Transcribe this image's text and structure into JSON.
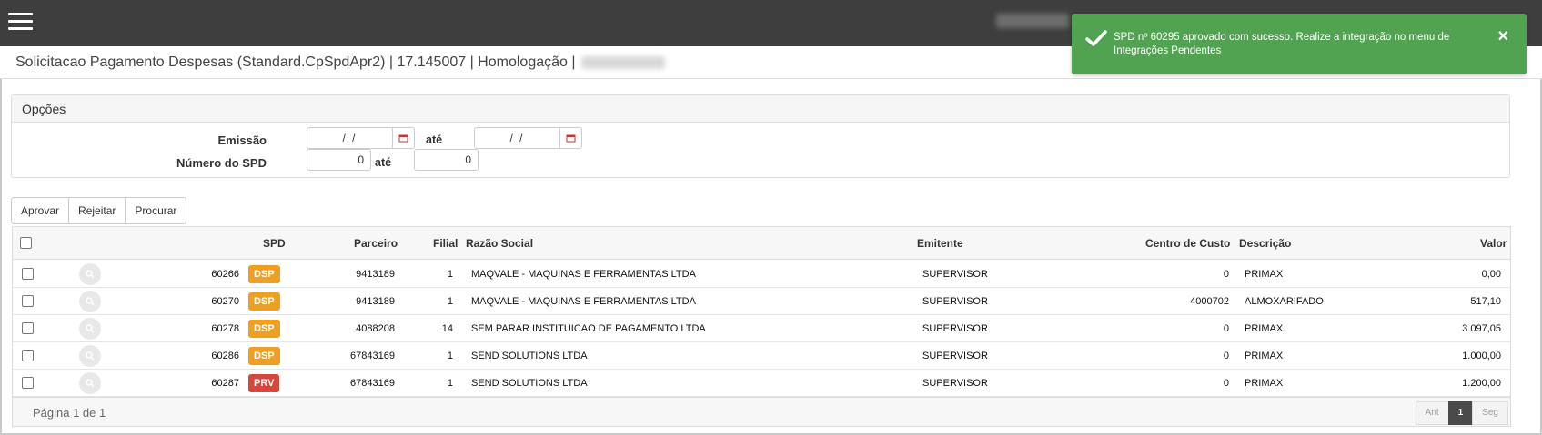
{
  "header": {
    "page_title": "Solicitacao Pagamento Despesas (Standard.CpSpdApr2) | 17.145007 | Homologação |"
  },
  "toast": {
    "message": "SPD nº 60295 aprovado com sucesso. Realize a integração no menu de Integrações Pendentes",
    "close": "×",
    "color": "#51a351"
  },
  "options": {
    "title": "Opções",
    "emissao_label": "Emissão",
    "numero_label": "Número do SPD",
    "ate_label": "até",
    "date_from": "/ /",
    "date_to": "/ /",
    "num_from": "0",
    "num_to": "0"
  },
  "toolbar": {
    "aprovar": "Aprovar",
    "rejeitar": "Rejeitar",
    "procurar": "Procurar"
  },
  "table": {
    "headers": {
      "spd": "SPD",
      "parceiro": "Parceiro",
      "filial": "Filial",
      "razao": "Razão Social",
      "emitente": "Emitente",
      "centro": "Centro de Custo",
      "descricao": "Descrição",
      "valor": "Valor"
    },
    "rows": [
      {
        "spd": "60266",
        "badge": "DSP",
        "parceiro": "9413189",
        "filial": "1",
        "razao": "MAQVALE - MAQUINAS E FERRAMENTAS LTDA",
        "emitente": "SUPERVISOR",
        "centro": "0",
        "descricao": "PRIMAX",
        "valor": "0,00"
      },
      {
        "spd": "60270",
        "badge": "DSP",
        "parceiro": "9413189",
        "filial": "1",
        "razao": "MAQVALE - MAQUINAS E FERRAMENTAS LTDA",
        "emitente": "SUPERVISOR",
        "centro": "4000702",
        "descricao": "ALMOXARIFADO",
        "valor": "517,10"
      },
      {
        "spd": "60278",
        "badge": "DSP",
        "parceiro": "4088208",
        "filial": "14",
        "razao": "SEM PARAR INSTITUICAO DE PAGAMENTO LTDA",
        "emitente": "SUPERVISOR",
        "centro": "0",
        "descricao": "PRIMAX",
        "valor": "3.097,05"
      },
      {
        "spd": "60286",
        "badge": "DSP",
        "parceiro": "67843169",
        "filial": "1",
        "razao": "SEND SOLUTIONS LTDA",
        "emitente": "SUPERVISOR",
        "centro": "0",
        "descricao": "PRIMAX",
        "valor": "1.000,00"
      },
      {
        "spd": "60287",
        "badge": "PRV",
        "parceiro": "67843169",
        "filial": "1",
        "razao": "SEND SOLUTIONS LTDA",
        "emitente": "SUPERVISOR",
        "centro": "0",
        "descricao": "PRIMAX",
        "valor": "1.200,00"
      }
    ],
    "badge_colors": {
      "DSP": "#f0a020",
      "PRV": "#d9453b"
    }
  },
  "footer": {
    "page_info": "Página 1 de 1",
    "prev": "Ant",
    "current": "1",
    "next": "Seg"
  }
}
